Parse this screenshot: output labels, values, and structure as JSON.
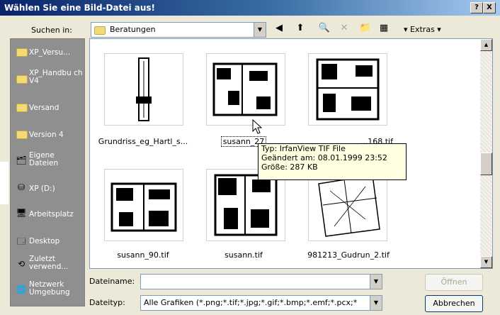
{
  "dialog": {
    "title": "Wählen Sie eine Bild-Datei aus!",
    "help_button": "?",
    "close_button": "X"
  },
  "lookin": {
    "label": "Suchen in:",
    "value": "Beratungen"
  },
  "toolbar": {
    "extras_label": "Extras"
  },
  "places": [
    {
      "label": "XP_Versu...",
      "icon": "folder-icon"
    },
    {
      "label": "XP_Handbu ch V4",
      "icon": "folder-icon"
    },
    {
      "label": "Versand",
      "icon": "folder-icon"
    },
    {
      "label": "Version 4",
      "icon": "folder-icon"
    },
    {
      "label": "Eigene Dateien",
      "icon": "documents-icon"
    },
    {
      "label": "XP (D:)",
      "icon": "drive-icon"
    },
    {
      "label": "Arbeitsplatz",
      "icon": "computer-icon"
    },
    {
      "label": "Desktop",
      "icon": "desktop-icon"
    },
    {
      "label": "Zuletzt verwend...",
      "icon": "recent-icon"
    },
    {
      "label": "Netzwerk Umgebung",
      "icon": "network-icon"
    }
  ],
  "files": [
    {
      "name": "Grundriss_eg_Hartl_s..."
    },
    {
      "name": "susann_27"
    },
    {
      "name": "...168.tif"
    },
    {
      "name": "susann_90.tif"
    },
    {
      "name": "susann.tif"
    },
    {
      "name": "981213_Gudrun_2.tif"
    }
  ],
  "tooltip": {
    "line1": "Typ: IrfanView TIF File",
    "line2": "Geändert am: 08.01.1999 23:52",
    "line3": "Größe: 287 KB"
  },
  "filename": {
    "label": "Dateiname:",
    "value": ""
  },
  "filetype": {
    "label": "Dateityp:",
    "value": "Alle Grafiken (*.png;*.tif;*.jpg;*.gif;*.bmp;*.emf;*.pcx;*"
  },
  "buttons": {
    "open": "Öffnen",
    "cancel": "Abbrechen"
  }
}
